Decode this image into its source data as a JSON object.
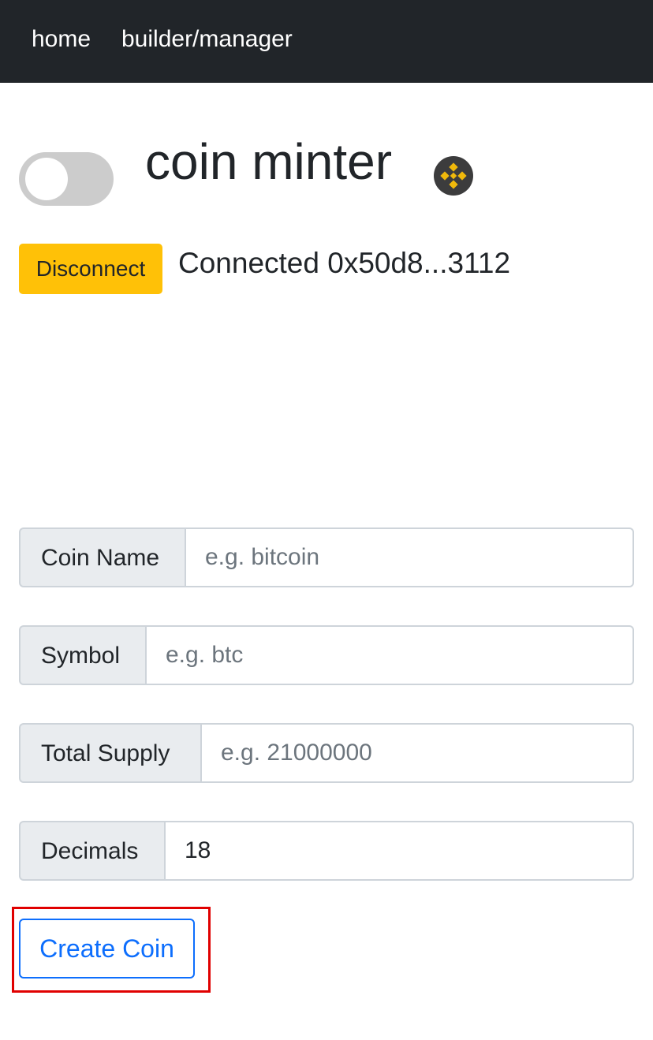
{
  "nav": {
    "home_label": "home",
    "builder_label": "builder/manager"
  },
  "header": {
    "title": "coin minter",
    "network_icon": "binance-logo-icon",
    "toggle_state": "off"
  },
  "wallet": {
    "disconnect_label": "Disconnect",
    "status": "Connected 0x50d8...3112"
  },
  "form": {
    "coin_name": {
      "label": "Coin Name",
      "placeholder": "e.g. bitcoin",
      "value": ""
    },
    "symbol": {
      "label": "Symbol",
      "placeholder": "e.g. btc",
      "value": ""
    },
    "total_supply": {
      "label": "Total Supply",
      "placeholder": "e.g. 21000000",
      "value": ""
    },
    "decimals": {
      "label": "Decimals",
      "placeholder": "",
      "value": "18"
    },
    "submit_label": "Create Coin"
  },
  "colors": {
    "navbar_bg": "#212529",
    "disconnect_bg": "#ffc107",
    "primary": "#0d6efd",
    "highlight": "#e00000",
    "logo_bg": "#3c3c3d",
    "logo_fg": "#f0b90b"
  }
}
